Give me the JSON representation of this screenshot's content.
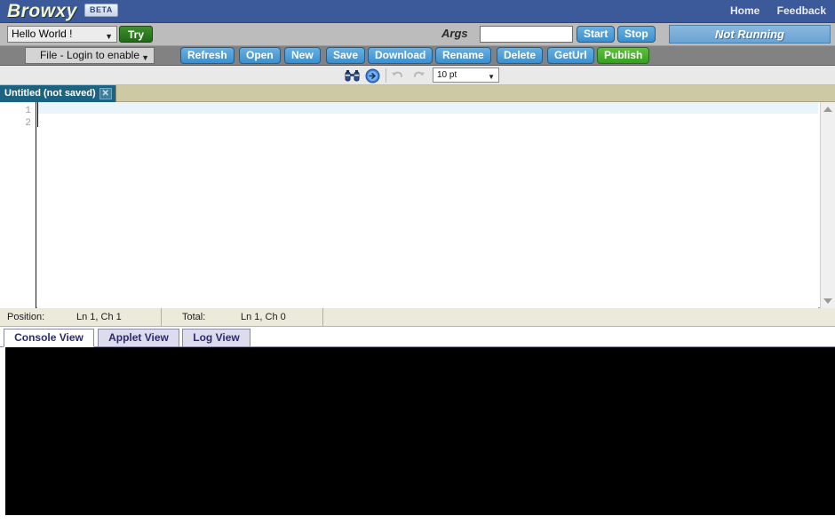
{
  "brand": {
    "name": "Browxy",
    "badge": "BETA",
    "links": [
      {
        "label": "Home",
        "name": "home-link"
      },
      {
        "label": "Feedback",
        "name": "feedback-link"
      }
    ]
  },
  "runbar": {
    "sample_selected": "Hello World !",
    "sample_options": [
      "Hello World !"
    ],
    "try_label": "Try",
    "args_label": "Args",
    "args_value": "",
    "args_placeholder": "",
    "start_label": "Start",
    "stop_label": "Stop",
    "run_status": "Not Running"
  },
  "filebar": {
    "file_menu_label": "File - Login to enable",
    "buttons": [
      {
        "label": "Refresh",
        "name": "refresh-button",
        "style": "blue"
      },
      {
        "label": "Open",
        "name": "open-button",
        "style": "blue"
      },
      {
        "label": "New",
        "name": "new-button",
        "style": "blue"
      },
      {
        "label": "Save",
        "name": "save-button",
        "style": "blue"
      },
      {
        "label": "Download",
        "name": "download-button",
        "style": "blue"
      },
      {
        "label": "Rename",
        "name": "rename-button",
        "style": "blue"
      },
      {
        "label": "Delete",
        "name": "delete-button",
        "style": "blue"
      },
      {
        "label": "GetUrl",
        "name": "geturl-button",
        "style": "blue"
      },
      {
        "label": "Publish",
        "name": "publish-button",
        "style": "green"
      }
    ]
  },
  "editor_toolbar": {
    "icons": [
      {
        "name": "find-binoculars-icon",
        "label": "find"
      },
      {
        "name": "goto-arrow-icon",
        "label": "go to"
      },
      {
        "name": "undo-icon",
        "label": "undo"
      },
      {
        "name": "redo-icon",
        "label": "redo"
      }
    ],
    "font_size_selected": "10 pt",
    "font_size_options": [
      "10 pt"
    ]
  },
  "file_tab": {
    "title": "Untitled (not saved)",
    "close_glyph": "✕"
  },
  "editor": {
    "line_numbers": [
      "1",
      "2"
    ],
    "lines": [
      "",
      ""
    ],
    "content": ""
  },
  "statusbar": {
    "position_label": "Position:",
    "position_value": "Ln 1, Ch 1",
    "total_label": "Total:",
    "total_value": "Ln 1, Ch 0"
  },
  "view_tabs": [
    {
      "label": "Console View",
      "name": "tab-console-view",
      "active": true
    },
    {
      "label": "Applet View",
      "name": "tab-applet-view",
      "active": false
    },
    {
      "label": "Log View",
      "name": "tab-log-view",
      "active": false
    }
  ],
  "console": {
    "text": "",
    "background": "#000000"
  },
  "colors": {
    "brand_bar": "#3c5a99",
    "run_toolbar": "#bcbcbc",
    "file_toolbar": "#828282",
    "editor_toolbar": "#e9e9e9",
    "tab_strip": "#cdc9a5",
    "active_file_tab": "#1c6281",
    "status_bar": "#eceadb",
    "accent_blue": "#3a8fce",
    "accent_green": "#35a01e",
    "console_bg": "#000000"
  }
}
